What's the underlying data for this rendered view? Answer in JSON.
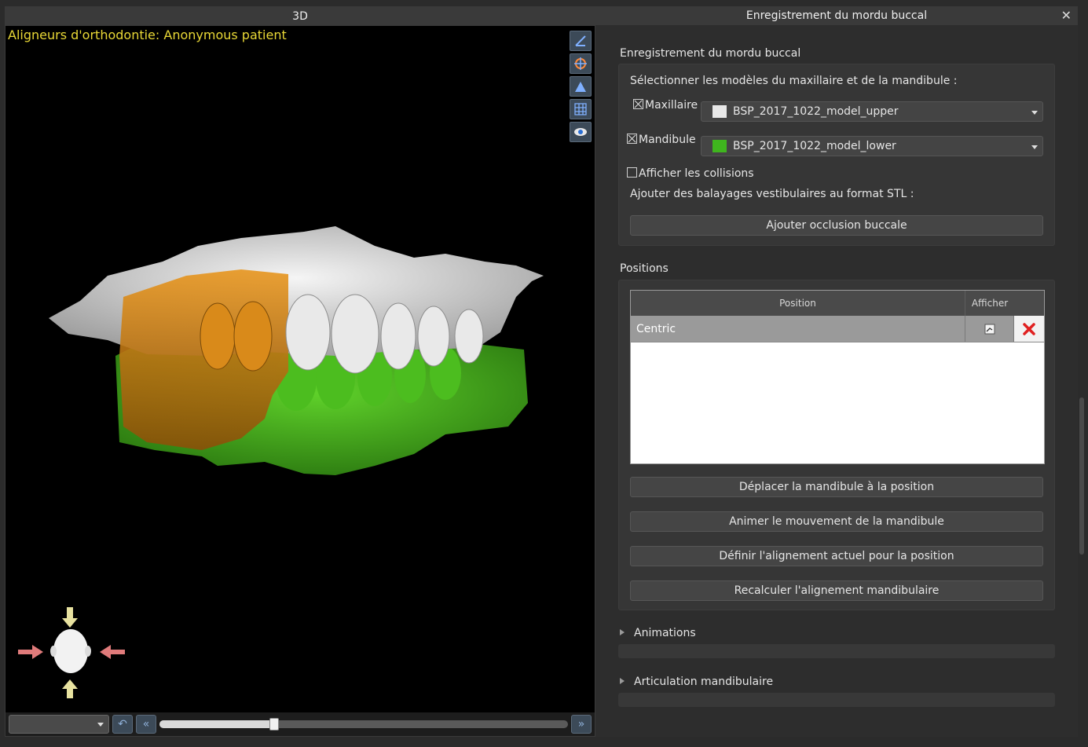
{
  "left_panel": {
    "title": "3D",
    "patient_label": "Aligneurs d'orthodontie: Anonymous patient",
    "tools": [
      "axis-view-icon",
      "rotate-view-icon",
      "elevation-view-icon",
      "grid-view-icon",
      "eye-view-icon"
    ],
    "timeline_progress": 0.28
  },
  "right_panel": {
    "title": "Enregistrement du mordu buccal",
    "section_label": "Enregistrement du mordu buccal",
    "select_models_label": "Sélectionner les modèles du maxillaire et de la mandibule :",
    "maxillaire": {
      "label": "Maxillaire",
      "checked": true,
      "value": "BSP_2017_1022_model_upper",
      "swatch": "#e8e8e8"
    },
    "mandibule": {
      "label": "Mandibule",
      "checked": true,
      "value": "BSP_2017_1022_model_lower",
      "swatch": "#3fb51e"
    },
    "collisions_label": "Afficher les collisions",
    "add_scans_label": "Ajouter des balayages vestibulaires au format STL :",
    "add_occlusion_button": "Ajouter occlusion buccale",
    "positions_label": "Positions",
    "table": {
      "col_position": "Position",
      "col_afficher": "Afficher",
      "rows": [
        {
          "name": "Centric"
        }
      ]
    },
    "buttons": {
      "move_mandible": "Déplacer la mandibule à la position",
      "animate": "Animer le mouvement de la mandibule",
      "set_alignment": "Définir l'alignement actuel pour la position",
      "recalculate": "Recalculer l'alignement mandibulaire"
    },
    "animations_label": "Animations",
    "articulation_label": "Articulation mandibulaire"
  }
}
